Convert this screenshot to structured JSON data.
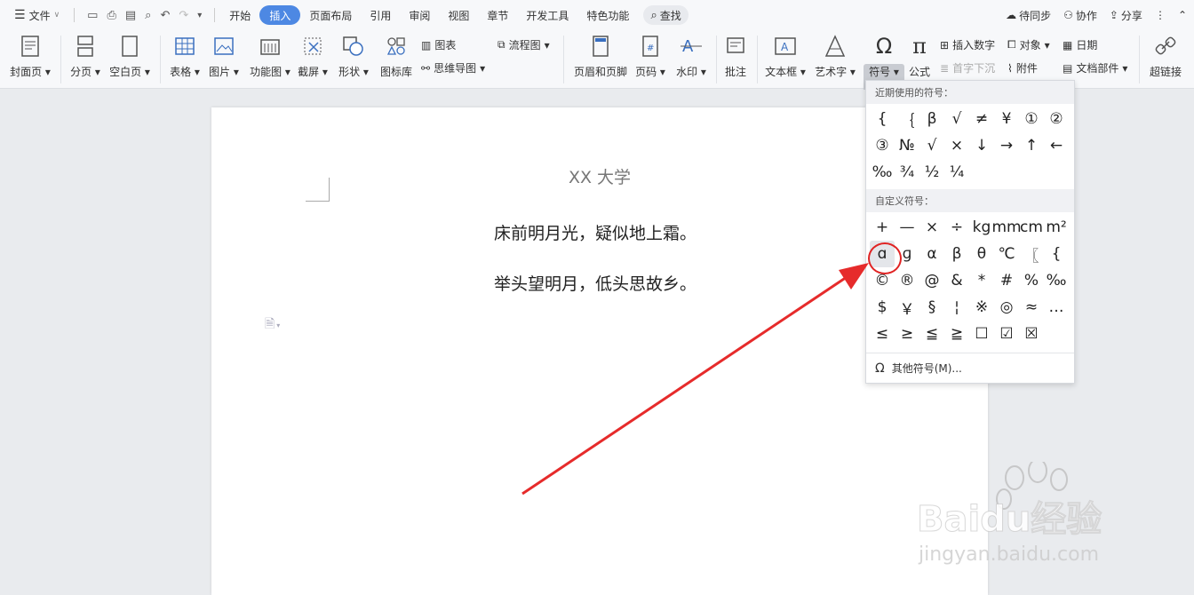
{
  "menubar": {
    "file": "文件",
    "tabs": [
      {
        "label": "开始"
      },
      {
        "label": "插入"
      },
      {
        "label": "页面布局"
      },
      {
        "label": "引用"
      },
      {
        "label": "审阅"
      },
      {
        "label": "视图"
      },
      {
        "label": "章节"
      },
      {
        "label": "开发工具"
      },
      {
        "label": "特色功能"
      }
    ],
    "search": "查找",
    "sync": "待同步",
    "collab": "协作",
    "share": "分享"
  },
  "ribbon": {
    "cover": "封面页",
    "pagebreak": "分页",
    "blankpage": "空白页",
    "table": "表格",
    "picture": "图片",
    "funcchart": "功能图",
    "screenshot": "截屏",
    "shape": "形状",
    "iconlib": "图标库",
    "chart": "图表",
    "mindmap": "思维导图",
    "flowchart": "流程图",
    "headerfooter": "页眉和页脚",
    "pagenum": "页码",
    "watermark": "水印",
    "comment": "批注",
    "textbox": "文本框",
    "arttext": "艺术字",
    "symbol": "符号",
    "formula": "公式",
    "insertnum": "插入数字",
    "dropcap": "首字下沉",
    "object": "对象",
    "attachment": "附件",
    "date": "日期",
    "docparts": "文档部件",
    "hyperlink": "超链接"
  },
  "document": {
    "title": "XX 大学",
    "line1": "床前明月光，疑似地上霜。",
    "line2": "举头望明月，低头思故乡。"
  },
  "symbols": {
    "recent_label": "近期使用的符号：",
    "recent": [
      "{",
      "｛",
      "β",
      "√",
      "≠",
      "¥",
      "①",
      "②",
      "③",
      "№",
      "√",
      "×",
      "↓",
      "→",
      "↑",
      "←",
      "‰",
      "¾",
      "½",
      "¼"
    ],
    "custom_label": "自定义符号：",
    "custom": [
      "+",
      "—",
      "×",
      "÷",
      "kg",
      "mm",
      "cm",
      "m²",
      "ɑ",
      "ɡ",
      "α",
      "β",
      "θ",
      "℃",
      "〖",
      "{",
      "©",
      "®",
      "@",
      "&",
      "*",
      "#",
      "%",
      "‰",
      "$",
      "￥",
      "§",
      "¦",
      "※",
      "◎",
      "≈",
      "…",
      "≤",
      "≥",
      "≦",
      "≧",
      "☐",
      "☑",
      "☒"
    ],
    "more": "其他符号(M)..."
  },
  "watermark": {
    "brand": "Baidu经验",
    "url": "jingyan.baidu.com"
  }
}
